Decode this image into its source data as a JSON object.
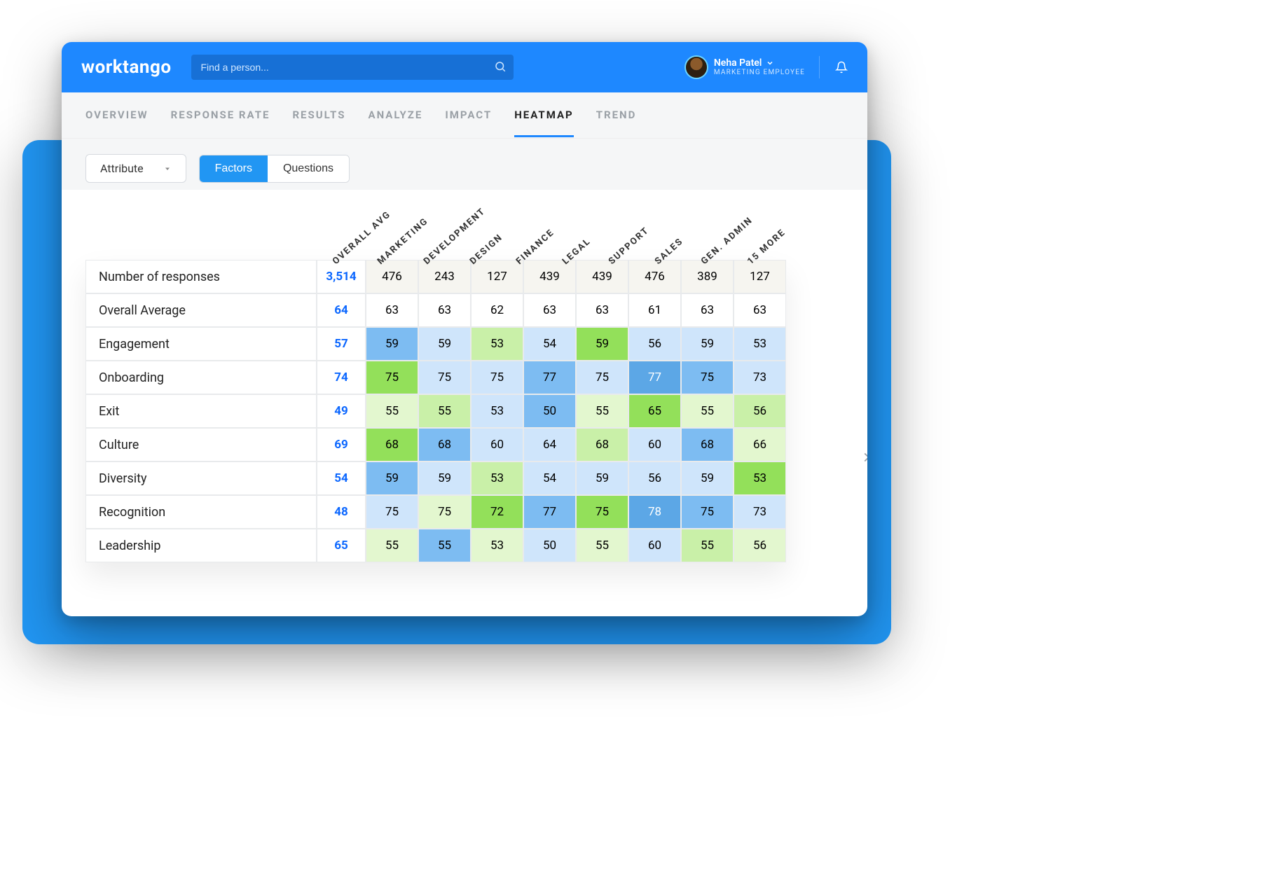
{
  "brand": "worktango",
  "search": {
    "placeholder": "Find a person..."
  },
  "user": {
    "name": "Neha Patel",
    "role": "MARKETING EMPLOYEE"
  },
  "tabs": [
    "OVERVIEW",
    "RESPONSE RATE",
    "RESULTS",
    "ANALYZE",
    "IMPACT",
    "HEATMAP",
    "TREND"
  ],
  "active_tab": "HEATMAP",
  "controls": {
    "attribute_label": "Attribute",
    "seg_factors": "Factors",
    "seg_questions": "Questions"
  },
  "diag_headers": [
    "OVERALL AVG",
    "MARKETING",
    "DEVELOPMENT",
    "DESIGN",
    "FINANCE",
    "LEGAL",
    "SUPPORT",
    "SALES",
    "GEN. ADMIN",
    "15 MORE"
  ],
  "heatmap": {
    "row_labels": [
      "Number of responses",
      "Overall Average",
      "Engagement",
      "Onboarding",
      "Exit",
      "Culture",
      "Diversity",
      "Recognition",
      "Leadership"
    ],
    "overall": [
      "3,514",
      "64",
      "57",
      "74",
      "49",
      "69",
      "54",
      "48",
      "65"
    ],
    "dept_values": [
      [
        "476",
        "243",
        "127",
        "439",
        "439",
        "476",
        "389",
        "127"
      ],
      [
        "63",
        "63",
        "62",
        "63",
        "63",
        "61",
        "63",
        "63"
      ],
      [
        "59",
        "59",
        "53",
        "54",
        "59",
        "56",
        "59",
        "53"
      ],
      [
        "75",
        "75",
        "75",
        "77",
        "75",
        "77",
        "75",
        "73"
      ],
      [
        "55",
        "55",
        "53",
        "50",
        "55",
        "65",
        "55",
        "56"
      ],
      [
        "68",
        "68",
        "60",
        "64",
        "68",
        "60",
        "68",
        "66"
      ],
      [
        "59",
        "59",
        "53",
        "54",
        "59",
        "56",
        "59",
        "53"
      ],
      [
        "75",
        "75",
        "72",
        "77",
        "75",
        "78",
        "75",
        "73"
      ],
      [
        "55",
        "55",
        "53",
        "50",
        "55",
        "60",
        "55",
        "56"
      ]
    ],
    "dept_colors": [
      [
        "w",
        "w",
        "w",
        "w",
        "w",
        "w",
        "w",
        "w"
      ],
      [
        "w",
        "w",
        "w",
        "w",
        "w",
        "w",
        "w",
        "w"
      ],
      [
        "b",
        "lb",
        "mg",
        "lb",
        "g",
        "lb",
        "lb",
        "lb"
      ],
      [
        "g",
        "lb",
        "lb",
        "b",
        "lb",
        "db",
        "b",
        "lb"
      ],
      [
        "lg",
        "mg",
        "lb",
        "b",
        "lg",
        "g",
        "lg",
        "mg"
      ],
      [
        "g",
        "b",
        "lb",
        "lb",
        "mg",
        "lb",
        "b",
        "lg"
      ],
      [
        "b",
        "lb",
        "mg",
        "lb",
        "lb",
        "lb",
        "lb",
        "g"
      ],
      [
        "lb",
        "lg",
        "g",
        "b",
        "g",
        "db",
        "b",
        "lb"
      ],
      [
        "lg",
        "b",
        "lg",
        "lb",
        "lg",
        "lb",
        "mg",
        "lg"
      ]
    ]
  },
  "chart_data": {
    "type": "heatmap",
    "title": "Heatmap — Factors by Department",
    "x_categories": [
      "Marketing",
      "Development",
      "Design",
      "Finance",
      "Legal",
      "Support",
      "Sales",
      "Gen. Admin"
    ],
    "y_categories": [
      "Number of responses",
      "Overall Average",
      "Engagement",
      "Onboarding",
      "Exit",
      "Culture",
      "Diversity",
      "Recognition",
      "Leadership"
    ],
    "overall_column": {
      "label": "Overall Avg",
      "values": [
        3514,
        64,
        57,
        74,
        49,
        69,
        54,
        48,
        65
      ]
    },
    "matrix": [
      [
        476,
        243,
        127,
        439,
        439,
        476,
        389,
        127
      ],
      [
        63,
        63,
        62,
        63,
        63,
        61,
        63,
        63
      ],
      [
        59,
        59,
        53,
        54,
        59,
        56,
        59,
        53
      ],
      [
        75,
        75,
        75,
        77,
        75,
        77,
        75,
        73
      ],
      [
        55,
        55,
        53,
        50,
        55,
        65,
        55,
        56
      ],
      [
        68,
        68,
        60,
        64,
        68,
        60,
        68,
        66
      ],
      [
        59,
        59,
        53,
        54,
        59,
        56,
        59,
        53
      ],
      [
        75,
        75,
        72,
        77,
        75,
        78,
        75,
        73
      ],
      [
        55,
        55,
        53,
        50,
        55,
        60,
        55,
        56
      ]
    ],
    "more_columns_hint": "15 MORE"
  }
}
